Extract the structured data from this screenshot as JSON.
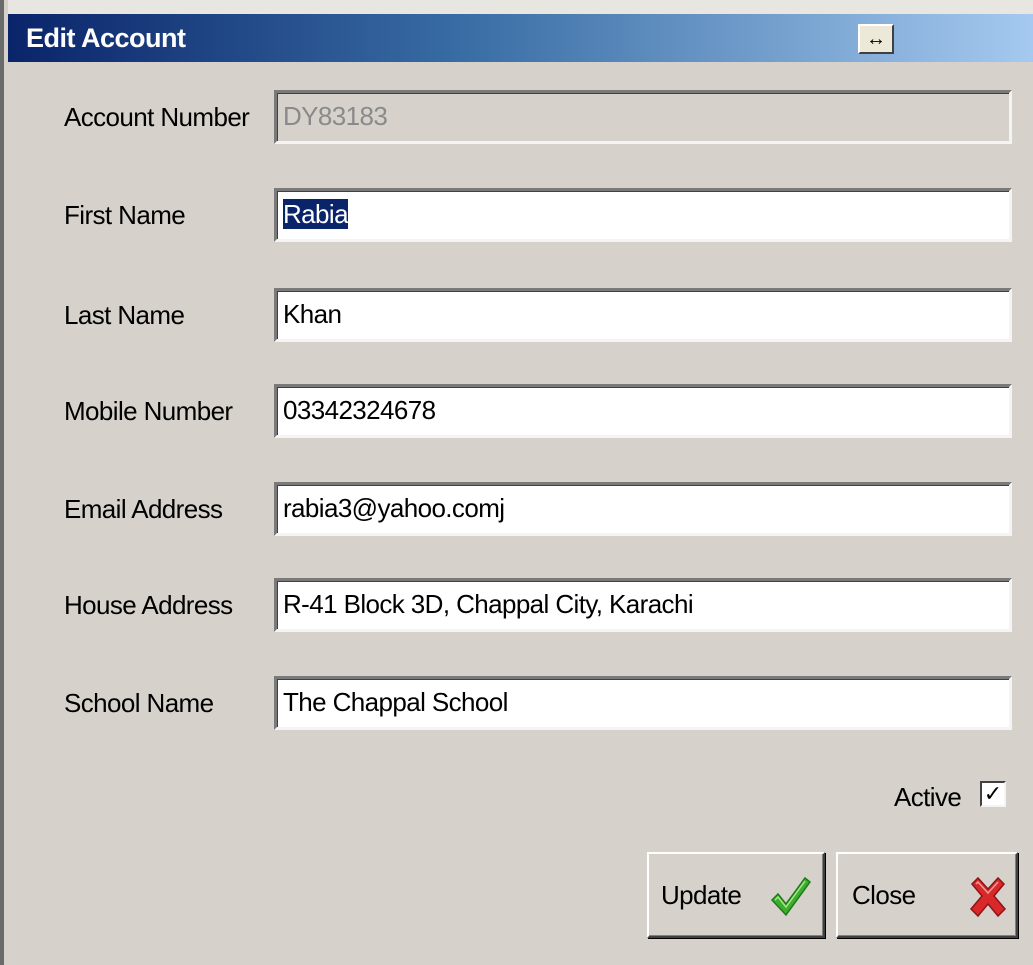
{
  "window": {
    "title": "Edit Account",
    "resize_button": "↔"
  },
  "form": {
    "fields": [
      {
        "label": "Account Number",
        "value": "DY83183"
      },
      {
        "label": "First Name",
        "value": "Rabia"
      },
      {
        "label": "Last Name",
        "value": "Khan"
      },
      {
        "label": "Mobile Number",
        "value": "03342324678"
      },
      {
        "label": "Email Address",
        "value": "rabia3@yahoo.comj"
      },
      {
        "label": "House Address",
        "value": "R-41 Block 3D, Chappal City, Karachi"
      },
      {
        "label": "School Name",
        "value": "The Chappal School"
      }
    ],
    "active_label": "Active",
    "active_checked_mark": "✓"
  },
  "buttons": {
    "update_label": "Update",
    "close_label": "Close",
    "update_icon": "green-checkmark-icon",
    "close_icon": "red-x-icon"
  },
  "colors": {
    "title_gradient_start": "#0a246a",
    "title_gradient_end": "#a6caf0",
    "selection": "#0a246a",
    "check_green": "#3cae2e",
    "close_red": "#d8282a"
  }
}
